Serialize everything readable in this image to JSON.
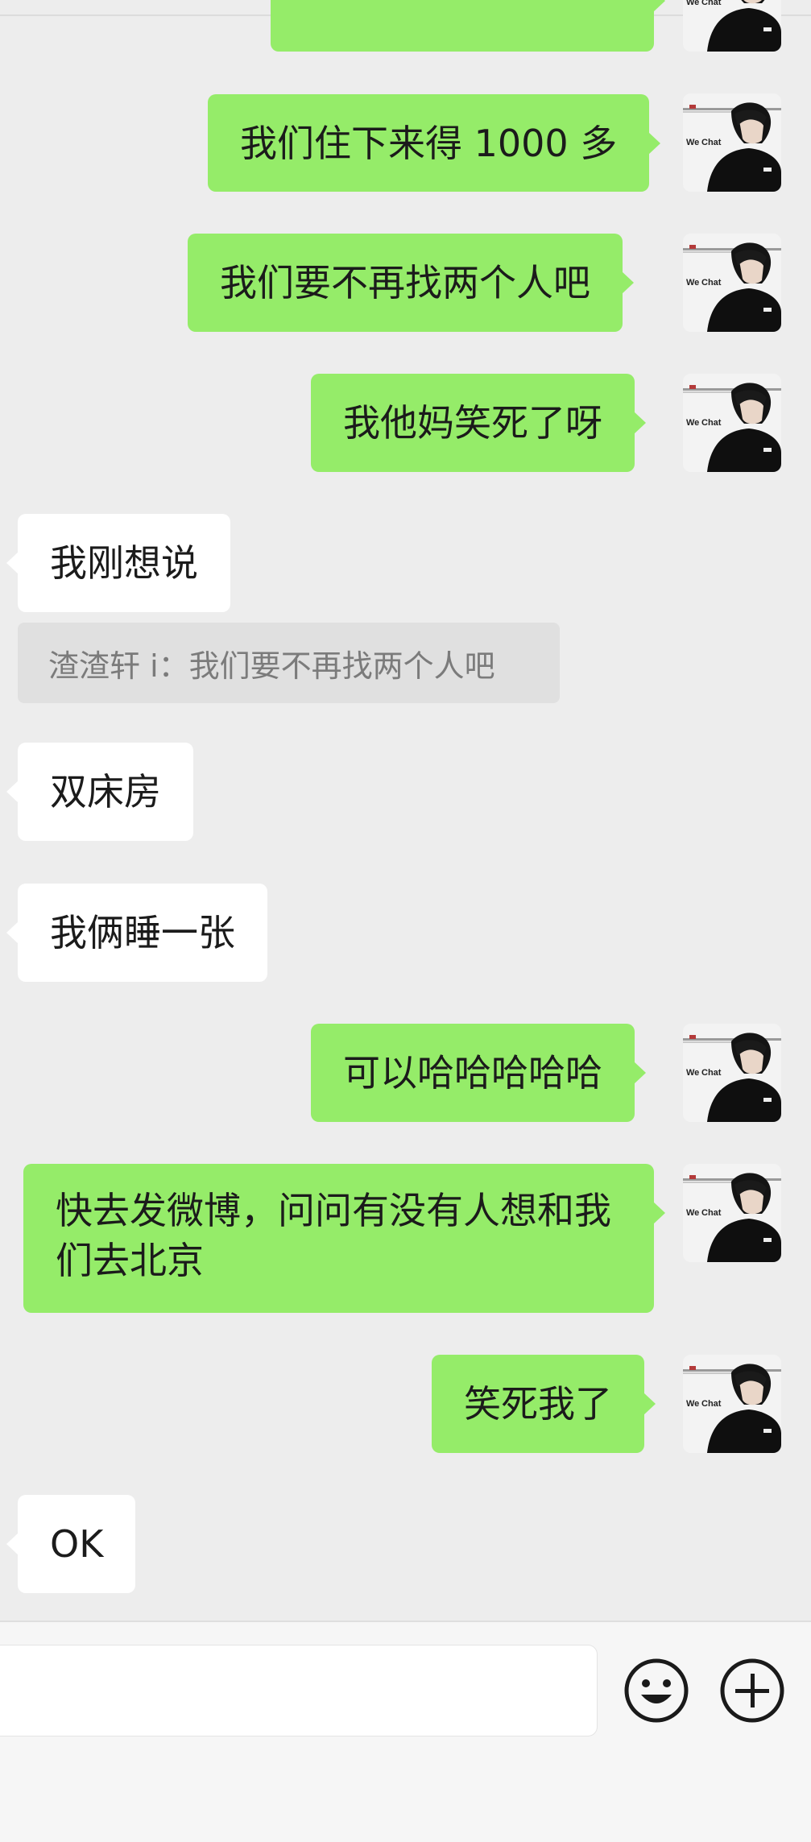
{
  "chat": {
    "messages": [
      {
        "sender": "me",
        "text": "我们住下来得 1000 多"
      },
      {
        "sender": "me",
        "text": "我们要不再找两个人吧"
      },
      {
        "sender": "me",
        "text": "我他妈笑死了呀"
      },
      {
        "sender": "other",
        "text": "我刚想说"
      },
      {
        "sender": "quote",
        "text": "渣渣轩 i：我们要不再找两个人吧"
      },
      {
        "sender": "other",
        "text": "双床房"
      },
      {
        "sender": "other",
        "text": "我俩睡一张"
      },
      {
        "sender": "me",
        "text": "可以哈哈哈哈哈"
      },
      {
        "sender": "me",
        "text": "快去发微博，问问有没有人想和我们去北京"
      },
      {
        "sender": "me",
        "text": "笑死我了"
      },
      {
        "sender": "other",
        "text": "OK"
      }
    ],
    "avatar_watermark": "WeChat"
  },
  "input_bar": {
    "message_value": "",
    "icons": [
      "emoji-icon",
      "plus-icon"
    ]
  },
  "colors": {
    "background": "#ededed",
    "my_bubble": "#95ec69",
    "other_bubble": "#ffffff",
    "quote_bg": "#e0e0e0",
    "quote_text": "#7b7b7b"
  }
}
